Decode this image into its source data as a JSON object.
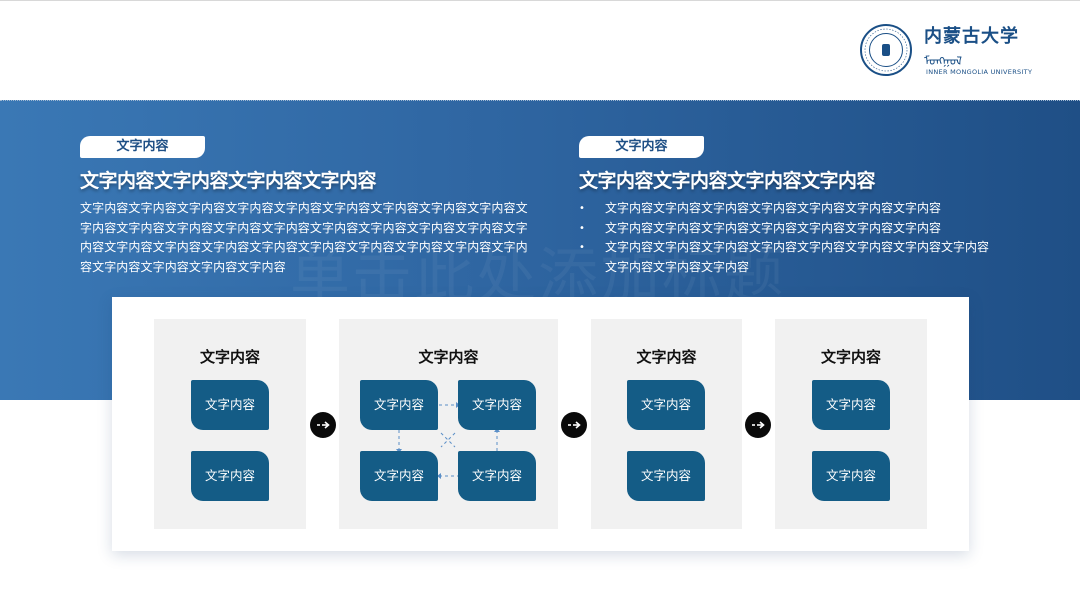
{
  "logo": {
    "name_cn": "内蒙古大学",
    "name_mn": "ᠮᠣᠩᠭᠣᠯ",
    "name_en": "INNER MONGOLIA UNIVERSITY",
    "seal_text": "INNER MONGOLIA UNIVERSITY"
  },
  "watermark": "单击此处添加标题",
  "left_section": {
    "tag": "文字内容",
    "heading": "文字内容文字内容文字内容文字内容",
    "paragraph": "文字内容文字内容文字内容文字内容文字内容文字内容文字内容文字内容文字内容文字内容文字内容文字内容文字内容文字内容文字内容文字内容文字内容文字内容文字内容文字内容文字内容文字内容文字内容文字内容文字内容文字内容文字内容文字内容文字内容文字内容文字内容文字内容"
  },
  "right_section": {
    "tag": "文字内容",
    "heading": "文字内容文字内容文字内容文字内容",
    "bullets": [
      "文字内容文字内容文字内容文字内容文字内容文字内容文字内容",
      "文字内容文字内容文字内容文字内容文字内容文字内容文字内容",
      "文字内容文字内容文字内容文字内容文字内容文字内容文字内容文字内容文字内容文字内容文字内容"
    ]
  },
  "process": {
    "stages": [
      {
        "title": "文字内容",
        "boxes": [
          "文字内容",
          "文字内容"
        ]
      },
      {
        "title": "文字内容",
        "boxes": [
          "文字内容",
          "文字内容",
          "文字内容",
          "文字内容"
        ]
      },
      {
        "title": "文字内容",
        "boxes": [
          "文字内容",
          "文字内容"
        ]
      },
      {
        "title": "文字内容",
        "boxes": [
          "文字内容",
          "文字内容"
        ]
      }
    ]
  },
  "colors": {
    "band_start": "#3a78b5",
    "band_end": "#1f4f86",
    "box": "#145c86",
    "stage_bg": "#f1f1f1",
    "arrow_bg": "#0a0a0a",
    "link_dashed": "#5b8fc7"
  }
}
